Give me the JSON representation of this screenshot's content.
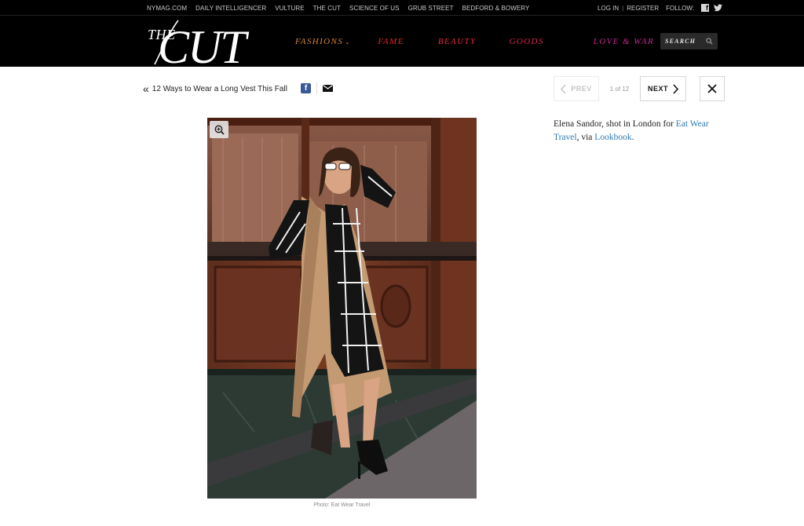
{
  "network_bar": {
    "links": [
      "NYMAG.COM",
      "DAILY INTELLIGENCER",
      "VULTURE",
      "THE CUT",
      "SCIENCE OF US",
      "GRUB STREET",
      "BEDFORD & BOWERY"
    ],
    "login": "LOG IN",
    "separator": "|",
    "register": "REGISTER",
    "follow": "FOLLOW:",
    "social_icons": [
      "facebook-icon",
      "twitter-icon"
    ]
  },
  "nav": {
    "logo_the": "THE",
    "logo_cut": "CUT",
    "items": [
      "FASHIONS",
      "FAME",
      "BEAUTY",
      "GOODS",
      "LOVE & WAR"
    ],
    "fashions_caret": "⌄",
    "search_label": "SEARCH",
    "colors": {
      "fashions": "#d4853a",
      "fame": "#e0262b",
      "beauty": "#e8263c",
      "goods": "#e0234f",
      "love_war": "#c22a92"
    }
  },
  "slideshow": {
    "back_chevron": "«",
    "back_title": "12 Ways to Wear a Long Vest This Fall",
    "share_fb": "f",
    "prev_label": "PREV",
    "counter": "1 of 12",
    "next_label": "NEXT"
  },
  "photo": {
    "credit": "Photo: Eat Wear Travel"
  },
  "caption": {
    "lead": "Elena Sandor, shot in London for ",
    "link1": "Eat Wear Travel",
    "middle": ", via ",
    "link2": "Lookbook",
    "end": ".",
    "link_color": "#2c7bb4"
  }
}
